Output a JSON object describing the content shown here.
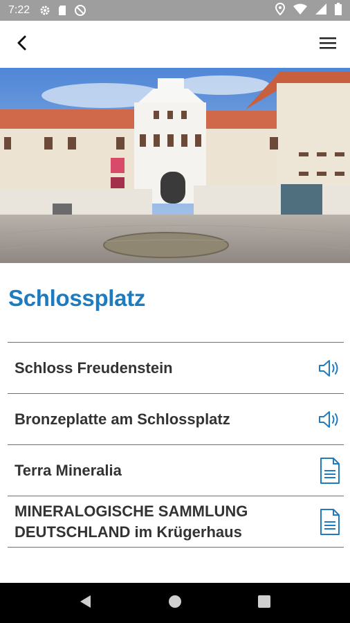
{
  "status_bar": {
    "time": "7:22",
    "icons_left": [
      "gear-icon",
      "sd-card-icon",
      "block-icon"
    ],
    "icons_right": [
      "location-icon",
      "wifi-icon",
      "signal-icon",
      "battery-icon"
    ]
  },
  "app_bar": {
    "back_icon": "back-arrow-icon",
    "menu_icon": "hamburger-menu-icon"
  },
  "hero_image": {
    "subject": "castle-square-photo"
  },
  "page": {
    "title": "Schlossplatz"
  },
  "items": [
    {
      "label": "Schloss Freudenstein",
      "icon": "speaker-icon"
    },
    {
      "label": "Bronzeplatte am Schlossplatz",
      "icon": "speaker-icon"
    },
    {
      "label": "Terra Mineralia",
      "icon": "document-icon"
    },
    {
      "label_line1": "MINERALOGISCHE SAMMLUNG",
      "label_line2": "DEUTSCHLAND im Krügerhaus",
      "icon": "document-icon"
    }
  ],
  "colors": {
    "accent": "#1f7bbf",
    "status_bar": "#9e9e9e",
    "nav_bar": "#000000"
  }
}
